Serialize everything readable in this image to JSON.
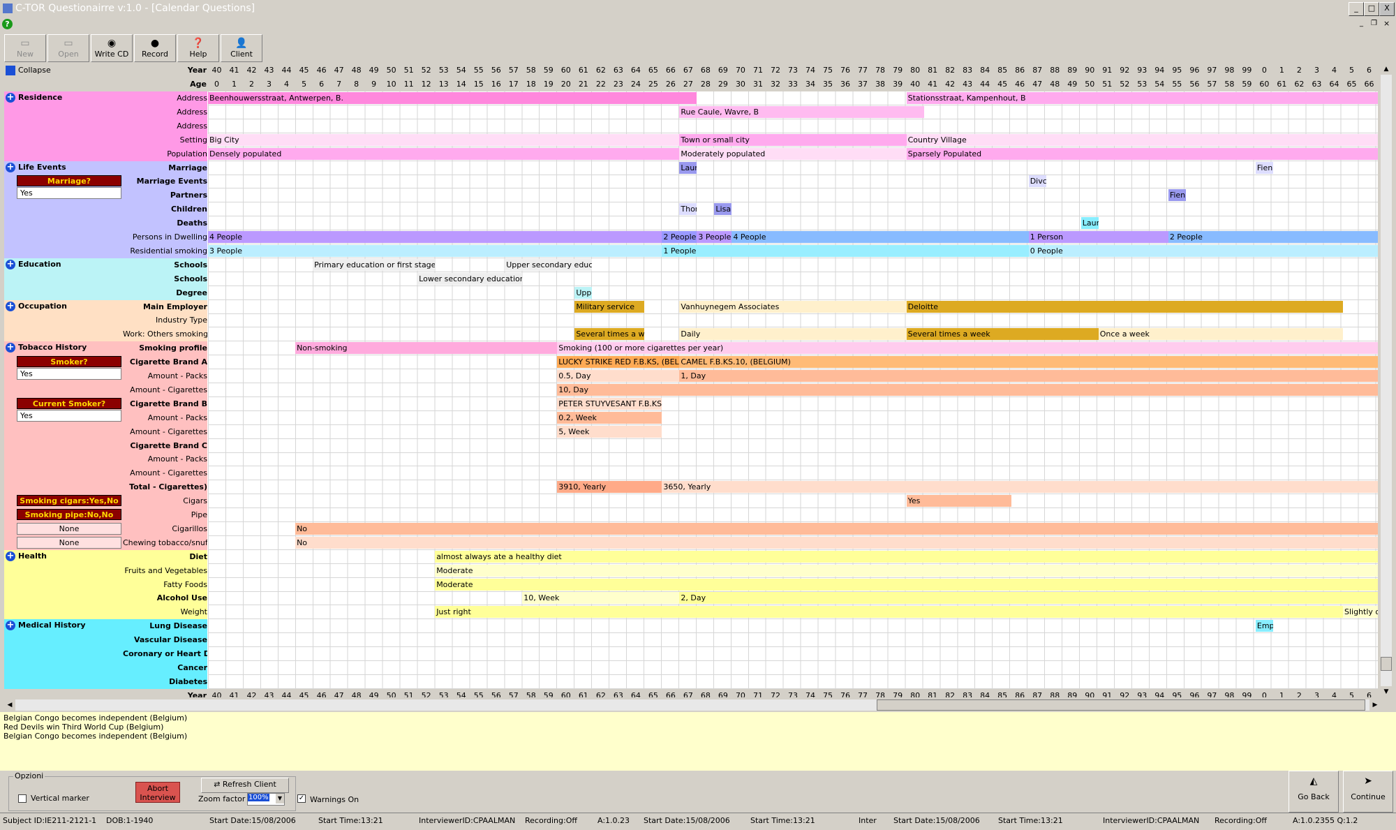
{
  "window": {
    "title": "C-TOR Questionairre v:1.0 - [Calendar Questions]",
    "buttons": [
      "_",
      "□",
      "X"
    ]
  },
  "toolbar": [
    {
      "label": "New",
      "icon": "new-icon",
      "enabled": false
    },
    {
      "label": "Open",
      "icon": "open-icon",
      "enabled": false
    },
    {
      "label": "Write CD",
      "icon": "cd-icon",
      "enabled": true
    },
    {
      "label": "Record",
      "icon": "record-icon",
      "enabled": true
    },
    {
      "label": "Help",
      "icon": "help-icon",
      "enabled": true
    },
    {
      "label": "Client",
      "icon": "client-icon",
      "enabled": true
    }
  ],
  "header": {
    "collapse_label": "Collapse",
    "year_label": "Year",
    "age_label": "Age",
    "years": [
      "40",
      "41",
      "42",
      "43",
      "44",
      "45",
      "46",
      "47",
      "48",
      "49",
      "50",
      "51",
      "52",
      "53",
      "54",
      "55",
      "56",
      "57",
      "58",
      "59",
      "60",
      "61",
      "62",
      "63",
      "64",
      "65",
      "66",
      "67",
      "68",
      "69",
      "70",
      "71",
      "72",
      "73",
      "74",
      "75",
      "76",
      "77",
      "78",
      "79",
      "80",
      "81",
      "82",
      "83",
      "84",
      "85",
      "86",
      "87",
      "88",
      "89",
      "90",
      "91",
      "92",
      "93",
      "94",
      "95",
      "96",
      "97",
      "98",
      "99",
      "0",
      "1",
      "2",
      "3",
      "4",
      "5",
      "6"
    ],
    "ages": [
      "0",
      "1",
      "2",
      "3",
      "4",
      "5",
      "6",
      "7",
      "8",
      "9",
      "10",
      "11",
      "12",
      "13",
      "14",
      "15",
      "16",
      "17",
      "18",
      "19",
      "20",
      "21",
      "22",
      "23",
      "24",
      "25",
      "26",
      "27",
      "28",
      "29",
      "30",
      "31",
      "32",
      "33",
      "34",
      "35",
      "36",
      "37",
      "38",
      "39",
      "40",
      "41",
      "42",
      "43",
      "44",
      "45",
      "46",
      "47",
      "48",
      "49",
      "50",
      "51",
      "52",
      "53",
      "54",
      "55",
      "56",
      "57",
      "58",
      "59",
      "60",
      "61",
      "62",
      "63",
      "64",
      "65",
      "66"
    ]
  },
  "sections": [
    {
      "name": "Residence",
      "color": "#ff99e6",
      "rows": [
        {
          "label": "Address",
          "bold": false,
          "bars": [
            {
              "s": 0,
              "e": 28,
              "text": "Beenhouwersstraat, Antwerpen, B.",
              "color": "#ff88dd"
            },
            {
              "s": 40,
              "e": 67,
              "text": "Stationsstraat, Kampenhout, B",
              "color": "#ffaaee"
            }
          ]
        },
        {
          "label": "Address",
          "bold": false,
          "bars": [
            {
              "s": 27,
              "e": 41,
              "text": "Rue Caule, Wavre, B",
              "color": "#ffbbf0"
            }
          ]
        },
        {
          "label": "Address",
          "bold": false,
          "bars": []
        },
        {
          "label": "Setting",
          "bold": false,
          "bars": [
            {
              "s": 0,
              "e": 27,
              "text": "Big City",
              "color": "#ffddf6"
            },
            {
              "s": 27,
              "e": 40,
              "text": "Town or small city",
              "color": "#ffaaee"
            },
            {
              "s": 40,
              "e": 67,
              "text": "Country Village",
              "color": "#ffddf6"
            }
          ]
        },
        {
          "label": "Population",
          "bold": false,
          "bars": [
            {
              "s": 0,
              "e": 27,
              "text": "Densely populated",
              "color": "#ffaaee"
            },
            {
              "s": 27,
              "e": 40,
              "text": "Moderately populated",
              "color": "#ffddf6"
            },
            {
              "s": 40,
              "e": 67,
              "text": "Sparsely Populated",
              "color": "#ffaaee"
            }
          ]
        }
      ]
    },
    {
      "name": "Life Events",
      "color": "#c2c2ff",
      "question": {
        "label": "Marriage?",
        "value": "Yes"
      },
      "rows": [
        {
          "label": "Marriage",
          "bold": true,
          "bars": [
            {
              "s": 27,
              "e": 28,
              "text": "Laur",
              "color": "#9999ee"
            },
            {
              "s": 60,
              "e": 61,
              "text": "Fien",
              "color": "#ddddff"
            }
          ]
        },
        {
          "label": "Marriage Events",
          "bold": true,
          "bars": [
            {
              "s": 47,
              "e": 48,
              "text": "Divc",
              "color": "#ddddff"
            }
          ]
        },
        {
          "label": "Partners",
          "bold": true,
          "bars": [
            {
              "s": 55,
              "e": 56,
              "text": "Fien",
              "color": "#9999ee"
            }
          ]
        },
        {
          "label": "Children",
          "bold": true,
          "bars": [
            {
              "s": 27,
              "e": 28,
              "text": "Thor",
              "color": "#ddddff"
            },
            {
              "s": 29,
              "e": 30,
              "text": "Lisa",
              "color": "#9999ee"
            }
          ]
        },
        {
          "label": "Deaths",
          "bold": true,
          "bars": [
            {
              "s": 50,
              "e": 51,
              "text": "Laur",
              "color": "#88eeff"
            }
          ]
        },
        {
          "label": "Persons in Dwelling",
          "bold": false,
          "bars": [
            {
              "s": 0,
              "e": 26,
              "text": "4  People",
              "color": "#bb99ff"
            },
            {
              "s": 26,
              "e": 28,
              "text": "2  People",
              "color": "#9999ff"
            },
            {
              "s": 28,
              "e": 30,
              "text": "3  People",
              "color": "#bb99ff"
            },
            {
              "s": 30,
              "e": 47,
              "text": "4  People",
              "color": "#88bbff"
            },
            {
              "s": 47,
              "e": 55,
              "text": "1  Person",
              "color": "#bb99ff"
            },
            {
              "s": 55,
              "e": 67,
              "text": "2  People",
              "color": "#88bbff"
            }
          ]
        },
        {
          "label": "Residential smoking",
          "bold": false,
          "bars": [
            {
              "s": 0,
              "e": 26,
              "text": "3 People",
              "color": "#bbeeff"
            },
            {
              "s": 26,
              "e": 47,
              "text": "1 People",
              "color": "#99eeff"
            },
            {
              "s": 47,
              "e": 67,
              "text": "0 People",
              "color": "#bbeeff"
            }
          ]
        }
      ]
    },
    {
      "name": "Education",
      "color": "#bbf3f6",
      "rows": [
        {
          "label": "Schools",
          "bold": true,
          "bars": [
            {
              "s": 6,
              "e": 13,
              "text": "Primary education or first stage of basic education",
              "color": "#eeeeee"
            },
            {
              "s": 17,
              "e": 22,
              "text": "Upper secondary education",
              "color": "#eeeeee"
            }
          ]
        },
        {
          "label": "Schools",
          "bold": true,
          "bars": [
            {
              "s": 12,
              "e": 18,
              "text": "Lower secondary education or second stage",
              "color": "#eeeeee"
            }
          ]
        },
        {
          "label": "Degree",
          "bold": true,
          "bars": [
            {
              "s": 21,
              "e": 22,
              "text": "Upper",
              "color": "#bbf3f6"
            }
          ]
        }
      ]
    },
    {
      "name": "Occupation",
      "color": "#ffe0c4",
      "rows": [
        {
          "label": "Main Employer",
          "bold": true,
          "bars": [
            {
              "s": 21,
              "e": 25,
              "text": "Military service",
              "color": "#ddaa22"
            },
            {
              "s": 27,
              "e": 40,
              "text": "Vanhuynegem Associates",
              "color": "#fff0cc"
            },
            {
              "s": 40,
              "e": 65,
              "text": "Deloitte",
              "color": "#ddaa22"
            }
          ]
        },
        {
          "label": "Industry Type",
          "bold": false,
          "bars": []
        },
        {
          "label": "Work: Others smoking",
          "bold": false,
          "bars": [
            {
              "s": 21,
              "e": 25,
              "text": "Several times a week",
              "color": "#ddaa22"
            },
            {
              "s": 27,
              "e": 40,
              "text": "Daily",
              "color": "#fff0cc"
            },
            {
              "s": 40,
              "e": 51,
              "text": "Several times a week",
              "color": "#ddaa22"
            },
            {
              "s": 51,
              "e": 65,
              "text": "Once a week",
              "color": "#fff0cc"
            }
          ]
        }
      ]
    },
    {
      "name": "Tobacco History",
      "color": "#ffc0c0",
      "questions": [
        {
          "label": "Smoker?",
          "value": "Yes"
        },
        {
          "label": "Current Smoker?",
          "value": "Yes"
        },
        {
          "label": "Smoking cigars:Yes,No",
          "value": ""
        },
        {
          "label": "Smoking pipe:No,No",
          "value": ""
        }
      ],
      "rows": [
        {
          "label": "Smoking profile",
          "bold": true,
          "bars": [
            {
              "s": 5,
              "e": 20,
              "text": "Non-smoking",
              "color": "#ffaadd"
            },
            {
              "s": 20,
              "e": 67,
              "text": "Smoking (100 or more cigarettes per year)",
              "color": "#ffccee"
            }
          ]
        },
        {
          "label": "Cigarette Brand A",
          "bold": true,
          "bars": [
            {
              "s": 20,
              "e": 27,
              "text": "LUCKY STRIKE RED F.B.KS, (BELGIUM)",
              "color": "#ffaa55"
            },
            {
              "s": 27,
              "e": 67,
              "text": "CAMEL F.B.KS.10, (BELGIUM)",
              "color": "#ffbb77"
            }
          ]
        },
        {
          "label": "Amount - Packs",
          "bold": false,
          "bars": [
            {
              "s": 20,
              "e": 27,
              "text": "0.5, Day",
              "color": "#ffddcc"
            },
            {
              "s": 27,
              "e": 67,
              "text": "1, Day",
              "color": "#ffbb99"
            }
          ]
        },
        {
          "label": "Amount - Cigarettes",
          "bold": false,
          "bars": [
            {
              "s": 20,
              "e": 67,
              "text": "10, Day",
              "color": "#ffbb99"
            }
          ]
        },
        {
          "label": "Cigarette Brand B",
          "bold": true,
          "bars": [
            {
              "s": 20,
              "e": 26,
              "text": "PETER STUYVESANT F.B.KS",
              "color": "#ffddcc"
            }
          ]
        },
        {
          "label": "Amount - Packs",
          "bold": false,
          "bars": [
            {
              "s": 20,
              "e": 26,
              "text": "0.2, Week",
              "color": "#ffbb99"
            }
          ]
        },
        {
          "label": "Amount - Cigarettes",
          "bold": false,
          "bars": [
            {
              "s": 20,
              "e": 26,
              "text": "5, Week",
              "color": "#ffddcc"
            }
          ]
        },
        {
          "label": "Cigarette Brand C",
          "bold": true,
          "bars": []
        },
        {
          "label": "Amount - Packs",
          "bold": false,
          "bars": []
        },
        {
          "label": "Amount - Cigarettes",
          "bold": false,
          "bars": []
        },
        {
          "label": "Total - Cigarettes)",
          "bold": true,
          "bars": [
            {
              "s": 20,
              "e": 26,
              "text": "3910, Yearly",
              "color": "#ffaa88"
            },
            {
              "s": 26,
              "e": 67,
              "text": "3650, Yearly",
              "color": "#ffddcc"
            }
          ]
        },
        {
          "label": "Cigars",
          "bold": false,
          "bars": [
            {
              "s": 40,
              "e": 46,
              "text": "Yes",
              "color": "#ffbb99"
            }
          ]
        },
        {
          "label": "Pipe",
          "bold": false,
          "bars": []
        },
        {
          "label": "Cigarillos",
          "bold": false,
          "bars": [
            {
              "s": 5,
              "e": 67,
              "text": "No",
              "color": "#ffbb99"
            }
          ]
        },
        {
          "label": "Chewing tobacco/snuff",
          "bold": false,
          "bars": [
            {
              "s": 5,
              "e": 39,
              "text": "No",
              "color": "#ffddcc"
            },
            {
              "s": 39,
              "e": 67,
              "text": "",
              "color": "#ffddcc"
            }
          ]
        }
      ],
      "none_values": [
        "None",
        "None"
      ]
    },
    {
      "name": "Health",
      "color": "#ffff99",
      "rows": [
        {
          "label": "Diet",
          "bold": true,
          "bars": [
            {
              "s": 13,
              "e": 67,
              "text": "almost always ate a healthy diet",
              "color": "#ffff99"
            }
          ]
        },
        {
          "label": "Fruits and Vegetables",
          "bold": false,
          "bars": [
            {
              "s": 13,
              "e": 39,
              "text": "Moderate",
              "color": "#ffffcc"
            },
            {
              "s": 39,
              "e": 67,
              "text": "",
              "color": "#ffffcc"
            }
          ]
        },
        {
          "label": "Fatty Foods",
          "bold": false,
          "bars": [
            {
              "s": 13,
              "e": 67,
              "text": "Moderate",
              "color": "#ffff99"
            }
          ]
        },
        {
          "label": "Alcohol Use",
          "bold": true,
          "bars": [
            {
              "s": 18,
              "e": 27,
              "text": "10, Week",
              "color": "#ffffcc"
            },
            {
              "s": 27,
              "e": 67,
              "text": "2, Day",
              "color": "#ffff99"
            }
          ]
        },
        {
          "label": "Weight",
          "bold": false,
          "bars": [
            {
              "s": 13,
              "e": 65,
              "text": "Just right",
              "color": "#ffff99"
            },
            {
              "s": 65,
              "e": 67,
              "text": "Slightly overweight",
              "color": "#ffffcc"
            }
          ]
        }
      ]
    },
    {
      "name": "Medical History",
      "color": "#66eeff",
      "rows": [
        {
          "label": "Lung Disease",
          "bold": true,
          "bars": [
            {
              "s": 60,
              "e": 61,
              "text": "Emp",
              "color": "#88eeff"
            }
          ]
        },
        {
          "label": "Vascular Disease",
          "bold": true,
          "bars": []
        },
        {
          "label": "Coronary or Heart Disease",
          "bold": true,
          "bars": []
        },
        {
          "label": "Cancer",
          "bold": true,
          "bars": []
        },
        {
          "label": "Diabetes",
          "bold": true,
          "bars": []
        }
      ]
    }
  ],
  "events": [
    "Belgian Congo becomes independent (Belgium)",
    "Red Devils win Third World Cup (Belgium)",
    "Belgian Congo becomes independent (Belgium)"
  ],
  "options": {
    "group_label": "Opzioni",
    "vertical_marker": "Vertical marker",
    "abort": "Abort Interview",
    "refresh": "Refresh Client",
    "zoom_label": "Zoom factor",
    "zoom_value": "100%",
    "warnings": "Warnings On",
    "go_back": "Go Back",
    "continue": "Continue"
  },
  "statusbar": [
    "Subject ID:IE211-2121-1",
    "DOB:1-1940",
    "Start Date:15/08/2006",
    "Start Time:13:21",
    "InterviewerID:CPAALMAN",
    "Recording:Off",
    "A:1.0.23",
    "Start Date:15/08/2006",
    "Start Time:13:21",
    "Inter",
    "Start Date:15/08/2006",
    "Start Time:13:21",
    "InterviewerID:CPAALMAN",
    "Recording:Off",
    "A:1.0.2355 Q:1.2"
  ]
}
